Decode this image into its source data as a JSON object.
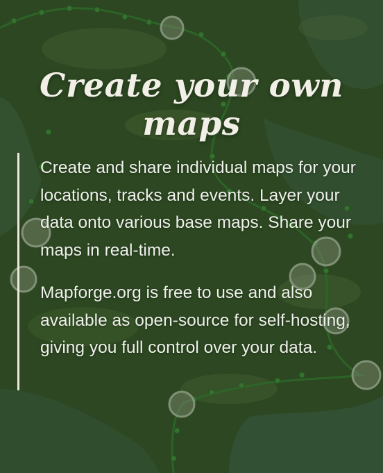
{
  "hero": {
    "title": "Create your own maps",
    "paragraphs": [
      "Create and share individual maps for your locations, tracks and events. Layer your data onto various base maps. Share your maps in real-time.",
      "Mapforge.org is free to use and also available as open-source for self-hosting, giving you full control over your data."
    ]
  },
  "colors": {
    "overlay": "#2e4a22",
    "text": "#eef0ea",
    "accent_border": "#eeeae0",
    "track_dot": "#3f8a3a"
  }
}
